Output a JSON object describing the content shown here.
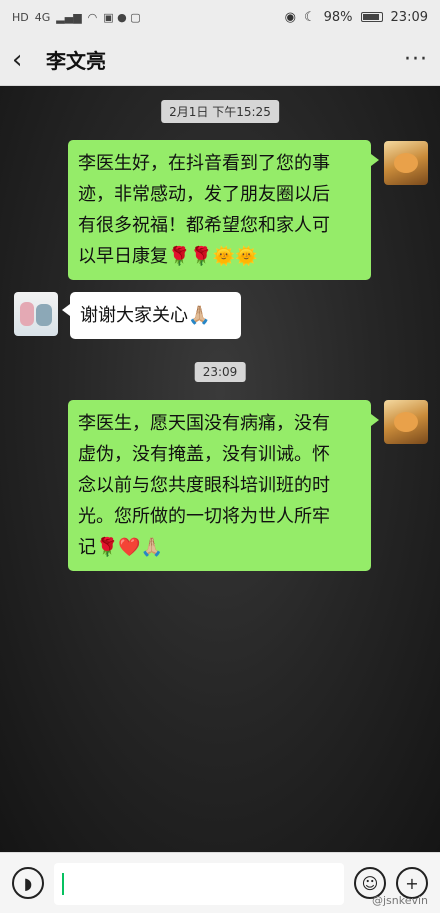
{
  "status_bar": {
    "left_labels": [
      "HD",
      "4G"
    ],
    "battery": "98%",
    "time": "23:09"
  },
  "header": {
    "title": "李文亮",
    "more": "···"
  },
  "messages": [
    {
      "type": "timestamp",
      "text": "2月1日 下午15:25"
    },
    {
      "type": "message",
      "side": "me",
      "lines": [
        "李医生好，在抖音看到了您的事",
        "迹，非常感动，发了朋友圈以后",
        "有很多祝福！都希望您和家人可",
        "以早日康复🌹🌹🌞🌞"
      ]
    },
    {
      "type": "message",
      "side": "them",
      "lines": [
        "谢谢大家关心🙏🏼"
      ]
    },
    {
      "type": "timestamp",
      "text": "23:09"
    },
    {
      "type": "message",
      "side": "me",
      "lines": [
        "李医生，愿天国没有病痛，没有",
        "虚伪，没有掩盖，没有训诫。怀",
        "念以前与您共度眼科培训班的时",
        "光。您所做的一切将为世人所牢",
        "记🌹❤️🙏🏼"
      ]
    }
  ],
  "input": {
    "value": ""
  },
  "watermark": "@jsnkevin"
}
